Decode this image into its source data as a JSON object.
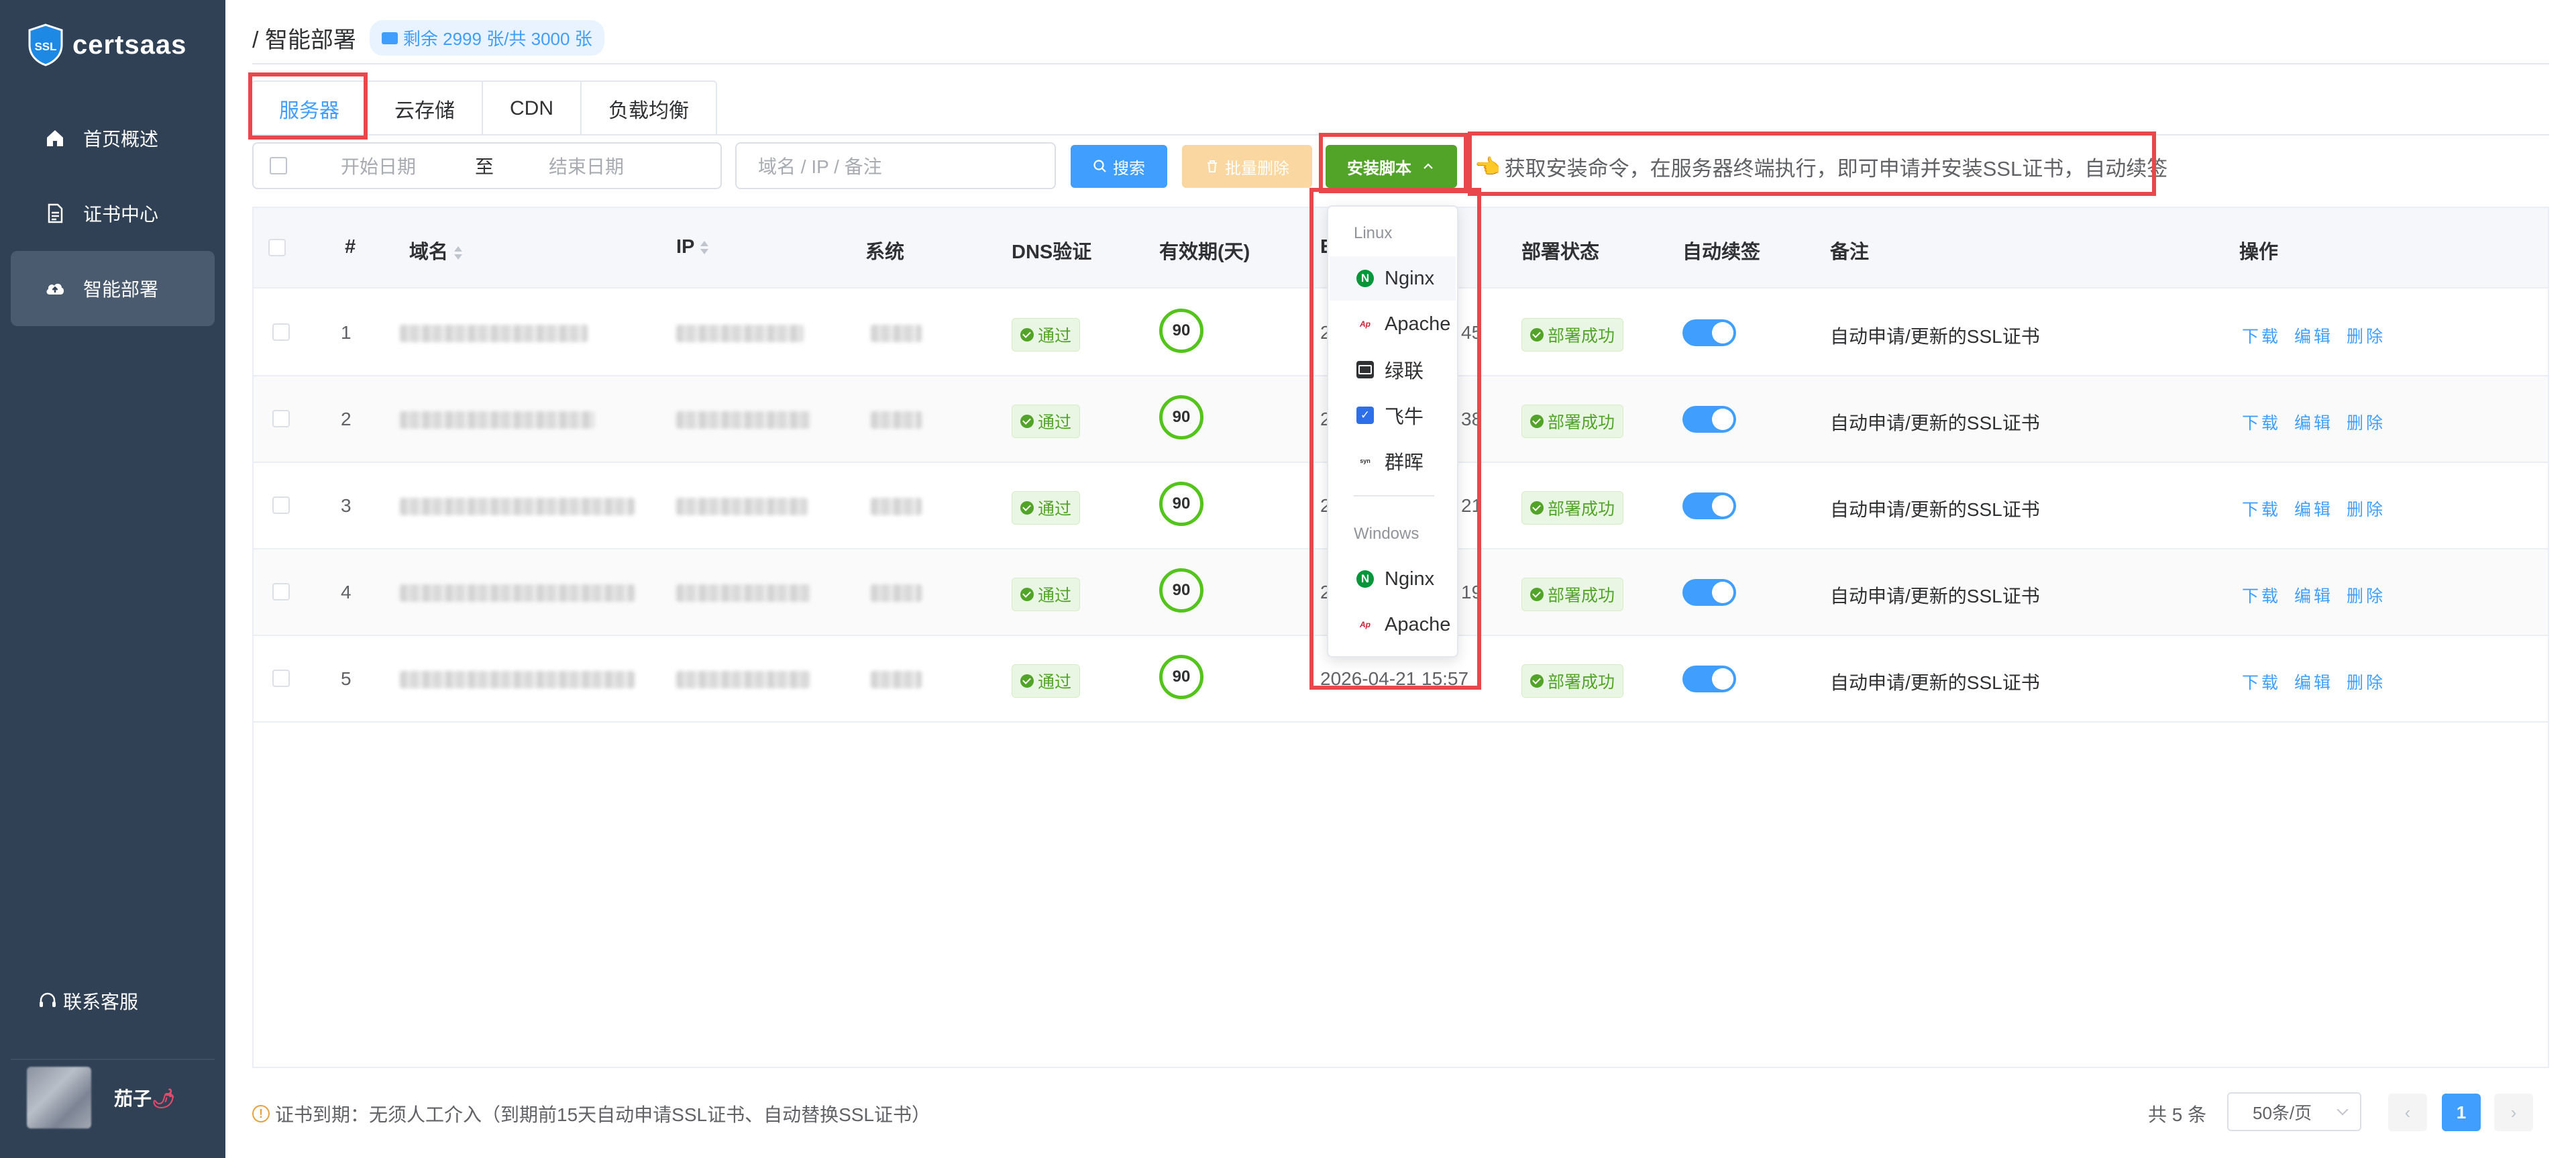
{
  "app": {
    "name": "certsaas",
    "logo_text": "SSL"
  },
  "sidebar": {
    "items": [
      {
        "label": "首页概述",
        "icon": "home-icon"
      },
      {
        "label": "证书中心",
        "icon": "document-icon"
      },
      {
        "label": "智能部署",
        "icon": "cloud-upload-icon",
        "active": true
      }
    ],
    "support_label": "联系客服",
    "user_name": "茄子",
    "user_suffix": "🌶"
  },
  "header": {
    "breadcrumb": "/ 智能部署",
    "quota": "剩余 2999 张/共 3000 张"
  },
  "tabs": [
    "服务器",
    "云存储",
    "CDN",
    "负载均衡"
  ],
  "toolbar": {
    "start_placeholder": "开始日期",
    "range_separator": "至",
    "end_placeholder": "结束日期",
    "keyword_placeholder": "域名 / IP / 备注",
    "search_label": "搜索",
    "batch_delete_label": "批量删除",
    "install_label": "安装脚本",
    "hint": "获取安装命令，在服务器终端执行，即可申请并安装SSL证书，自动续签"
  },
  "table": {
    "headers": {
      "index": "#",
      "domain": "域名",
      "ip": "IP",
      "system": "系统",
      "dns": "DNS验证",
      "validity": "有效期(天)",
      "expiry_partial": "E",
      "deploy": "部署状态",
      "renew": "自动续签",
      "remark": "备注",
      "ops": "操作"
    },
    "rows": [
      {
        "index": "1",
        "dns": "通过",
        "validity": "90",
        "expiry_tail": "45",
        "deploy": "部署成功",
        "renew": true,
        "remark": "自动申请/更新的SSL证书"
      },
      {
        "index": "2",
        "dns": "通过",
        "validity": "90",
        "expiry_tail": "38",
        "deploy": "部署成功",
        "renew": true,
        "remark": "自动申请/更新的SSL证书"
      },
      {
        "index": "3",
        "dns": "通过",
        "validity": "90",
        "expiry_tail": "21",
        "deploy": "部署成功",
        "renew": true,
        "remark": "自动申请/更新的SSL证书"
      },
      {
        "index": "4",
        "dns": "通过",
        "validity": "90",
        "expiry_tail": "19",
        "deploy": "部署成功",
        "renew": true,
        "remark": "自动申请/更新的SSL证书"
      },
      {
        "index": "5",
        "dns": "通过",
        "validity": "90",
        "expiry": "2026-04-21 15:57",
        "deploy": "部署成功",
        "renew": true,
        "remark": "自动申请/更新的SSL证书"
      }
    ],
    "expiry_head": "2",
    "ops": {
      "download": "下载",
      "edit": "编辑",
      "delete": "删除"
    }
  },
  "dropdown": {
    "linux_label": "Linux",
    "linux_items": [
      {
        "label": "Nginx",
        "icon": "nginx-icon"
      },
      {
        "label": "Apache",
        "icon": "apache-icon"
      },
      {
        "label": "绿联",
        "icon": "ugreen-icon"
      },
      {
        "label": "飞牛",
        "icon": "fnos-icon"
      },
      {
        "label": "群晖",
        "icon": "synology-icon"
      }
    ],
    "windows_label": "Windows",
    "windows_items": [
      {
        "label": "Nginx",
        "icon": "nginx-icon"
      },
      {
        "label": "Apache",
        "icon": "apache-icon"
      }
    ]
  },
  "footer": {
    "note": "证书到期：无须人工介入（到期前15天自动申请SSL证书、自动替换SSL证书）",
    "total": "共 5 条",
    "page_size": "50条/页",
    "current_page": "1"
  },
  "colors": {
    "sidebar_bg": "#304156",
    "primary": "#409eff",
    "success": "#52a428",
    "highlight": "#e8474c"
  }
}
